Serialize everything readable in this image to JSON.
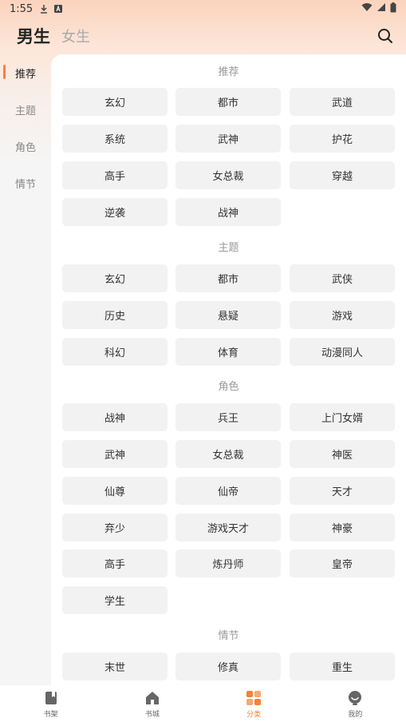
{
  "status": {
    "time": "1:55"
  },
  "header": {
    "gender_active": "男生",
    "gender_inactive": "女生"
  },
  "sidebar": {
    "items": [
      {
        "label": "推荐",
        "active": true
      },
      {
        "label": "主题",
        "active": false
      },
      {
        "label": "角色",
        "active": false
      },
      {
        "label": "情节",
        "active": false
      }
    ]
  },
  "sections": [
    {
      "title": "推荐",
      "tags": [
        "玄幻",
        "都市",
        "武道",
        "系统",
        "武神",
        "护花",
        "高手",
        "女总裁",
        "穿越",
        "逆袭",
        "战神"
      ]
    },
    {
      "title": "主题",
      "tags": [
        "玄幻",
        "都市",
        "武侠",
        "历史",
        "悬疑",
        "游戏",
        "科幻",
        "体育",
        "动漫同人"
      ]
    },
    {
      "title": "角色",
      "tags": [
        "战神",
        "兵王",
        "上门女婿",
        "武神",
        "女总裁",
        "神医",
        "仙尊",
        "仙帝",
        "天才",
        "弃少",
        "游戏天才",
        "神豪",
        "高手",
        "炼丹师",
        "皇帝",
        "学生"
      ]
    },
    {
      "title": "情节",
      "tags": [
        "末世",
        "修真",
        "重生"
      ]
    }
  ],
  "bottom_nav": [
    {
      "label": "书架",
      "icon": "bookshelf-icon",
      "active": false
    },
    {
      "label": "书城",
      "icon": "home-icon",
      "active": false
    },
    {
      "label": "分类",
      "icon": "category-icon",
      "active": true
    },
    {
      "label": "我的",
      "icon": "profile-icon",
      "active": false
    }
  ],
  "colors": {
    "accent": "#f5823a",
    "tag_bg": "#f2f2f2"
  }
}
